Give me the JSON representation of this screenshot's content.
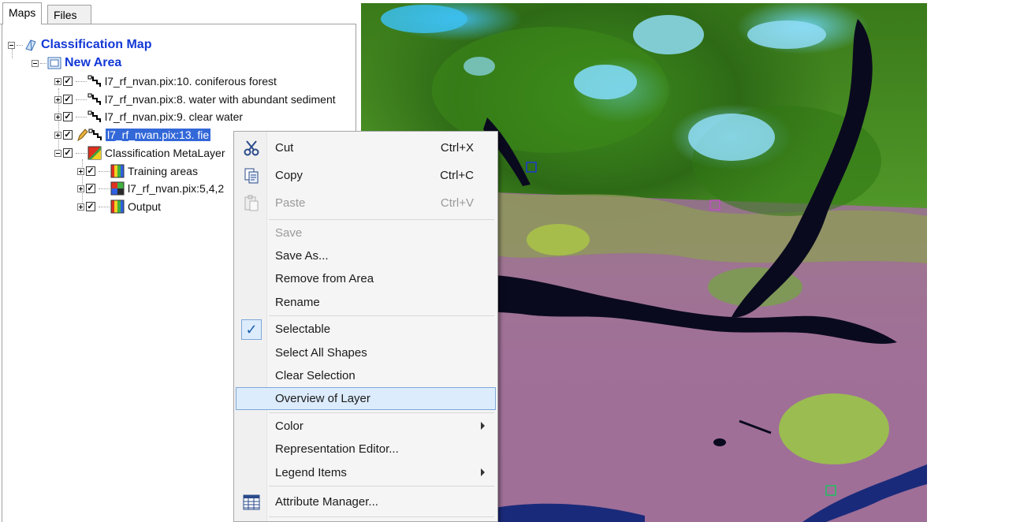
{
  "tabs": [
    {
      "label": "Maps",
      "active": true
    },
    {
      "label": "Files",
      "active": false
    }
  ],
  "tree": {
    "root": "Classification Map",
    "area": "New Area",
    "layers": [
      "l7_rf_nvan.pix:10. coniferous forest",
      "l7_rf_nvan.pix:8. water with abundant sediment",
      "l7_rf_nvan.pix:9. clear water",
      "l7_rf_nvan.pix:13. fie"
    ],
    "metalayer": "Classification MetaLayer",
    "meta_children": [
      "Training areas",
      "l7_rf_nvan.pix:5,4,2",
      "Output"
    ]
  },
  "context_menu": {
    "cut": {
      "label": "Cut",
      "shortcut": "Ctrl+X"
    },
    "copy": {
      "label": "Copy",
      "shortcut": "Ctrl+C"
    },
    "paste": {
      "label": "Paste",
      "shortcut": "Ctrl+V"
    },
    "save": "Save",
    "save_as": "Save As...",
    "remove": "Remove from Area",
    "rename": "Rename",
    "selectable": "Selectable",
    "select_all": "Select All Shapes",
    "clear_selection": "Clear Selection",
    "overview": "Overview of Layer",
    "color": "Color",
    "representation": "Representation Editor...",
    "legend": "Legend Items",
    "attribute_manager": "Attribute Manager..."
  },
  "colors": {
    "tree_title": "#1238d6",
    "selection": "#3368d8",
    "menu_highlight": "#dcecfc"
  }
}
